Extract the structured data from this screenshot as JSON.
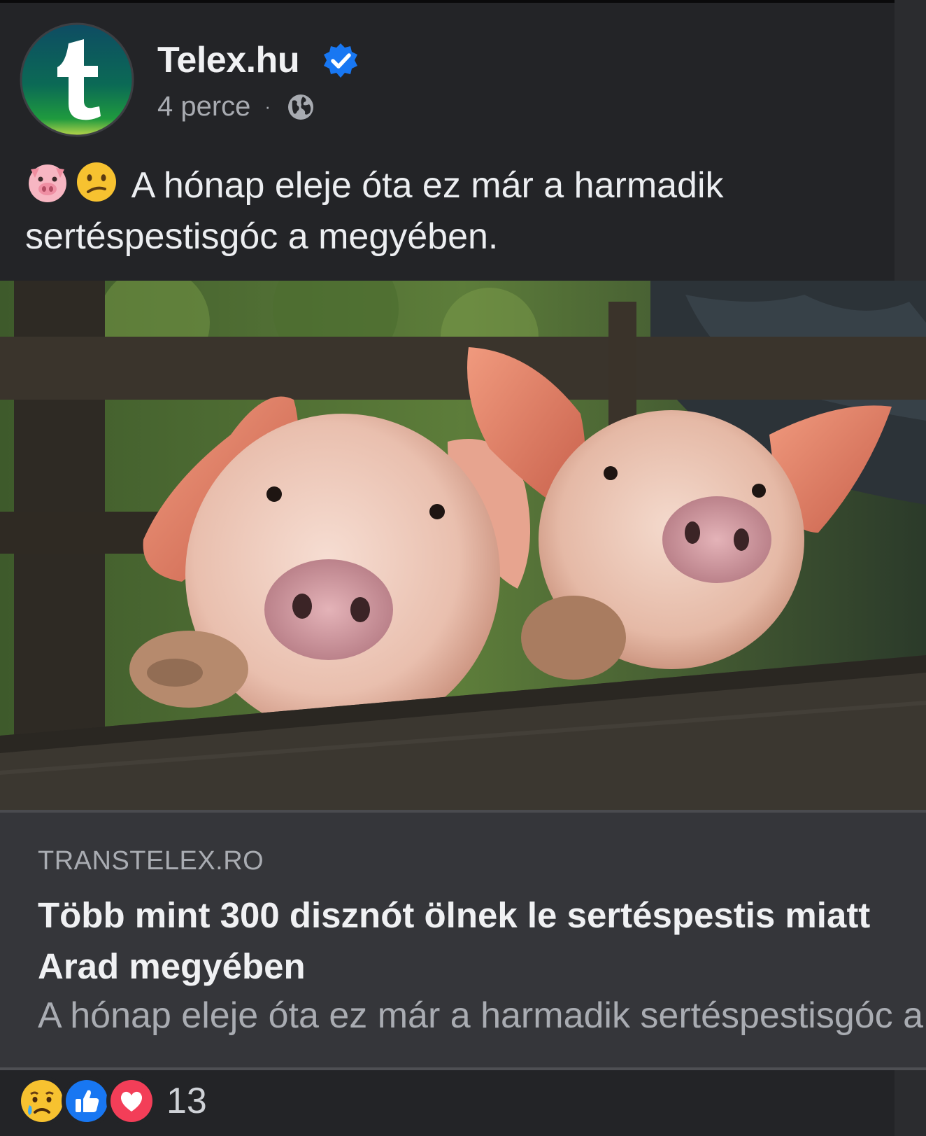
{
  "post": {
    "page_name": "Telex.hu",
    "verified": true,
    "time": "4 perce",
    "separator": "·",
    "audience_icon": "globe-icon",
    "text_emojis": [
      "pig-face-emoji",
      "confused-face-emoji"
    ],
    "text": "A hónap eleje óta ez már a harmadik sertéspestisgóc a megyében."
  },
  "link_preview": {
    "domain": "TRANSTELEX.RO",
    "title": "Több mint 300 disznót ölnek le sertéspestis miatt Arad megyében",
    "description": "A hónap eleje óta ez már a harmadik sertéspestisgóc a megyében."
  },
  "reactions": {
    "types": [
      "sad-reaction-icon",
      "like-reaction-icon",
      "love-reaction-icon"
    ],
    "count": "13"
  },
  "colors": {
    "background": "#232427",
    "card": "#35363a",
    "verified": "#1877f2",
    "love": "#f33e58"
  }
}
